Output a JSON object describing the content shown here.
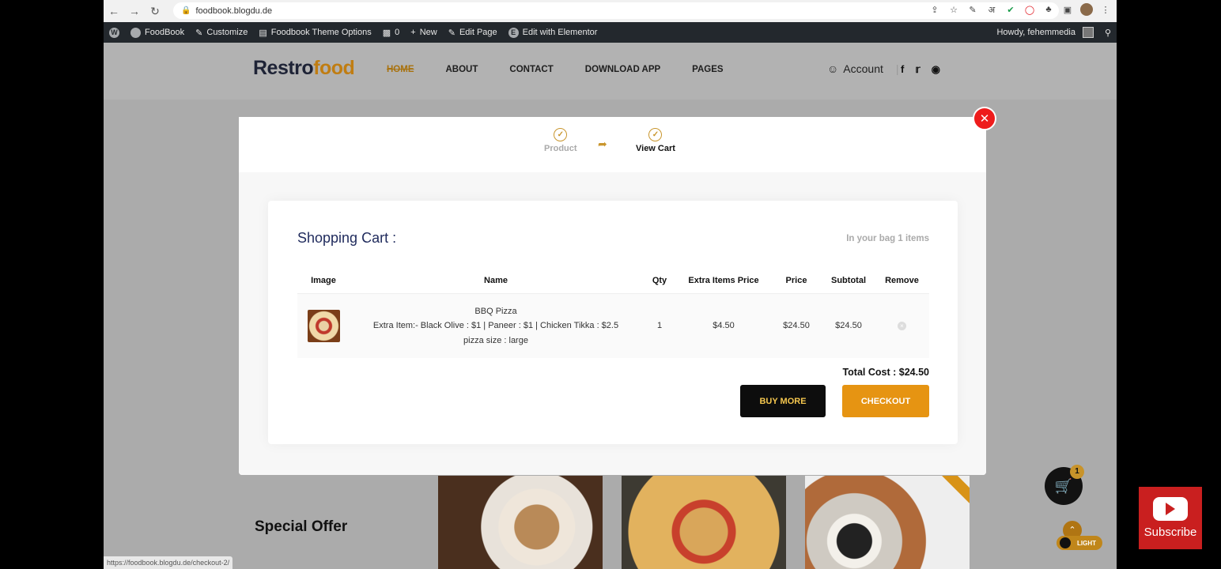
{
  "browser": {
    "url": "foodbook.blogdu.de",
    "status_url": "https://foodbook.blogdu.de/checkout-2/"
  },
  "wp_bar": {
    "site": "FoodBook",
    "customize": "Customize",
    "theme_options": "Foodbook Theme Options",
    "comments": "0",
    "new": "New",
    "edit_page": "Edit Page",
    "edit_elementor": "Edit with Elementor",
    "howdy": "Howdy, fehemmedia"
  },
  "header": {
    "logo_main": "Restro",
    "logo_accent": "food",
    "nav": [
      "HOME",
      "ABOUT",
      "CONTACT",
      "DOWNLOAD APP",
      "PAGES"
    ],
    "account": "Account"
  },
  "modal": {
    "step1": "Product",
    "step2": "View Cart",
    "cart_title": "Shopping Cart :",
    "bag_count": "In your bag 1 items",
    "columns": [
      "Image",
      "Name",
      "Qty",
      "Extra Items Price",
      "Price",
      "Subtotal",
      "Remove"
    ],
    "item": {
      "name": "BBQ Pizza",
      "extras": "Extra Item:- Black Olive : $1 | Paneer : $1 | Chicken Tikka : $2.5",
      "size": "pizza size : large",
      "qty": "1",
      "extra_price": "$4.50",
      "price": "$24.50",
      "subtotal": "$24.50"
    },
    "total": "Total Cost : $24.50",
    "buy_more": "BUY MORE",
    "checkout": "CHECKOUT"
  },
  "page": {
    "special_offer": "Special Offer",
    "cart_count": "1",
    "light_label": "LIGHT"
  },
  "youtube": {
    "subscribe": "Subscribe"
  },
  "colors": {
    "accent": "#e69412",
    "close": "#ee1c1c",
    "title": "#1f2a5c"
  }
}
